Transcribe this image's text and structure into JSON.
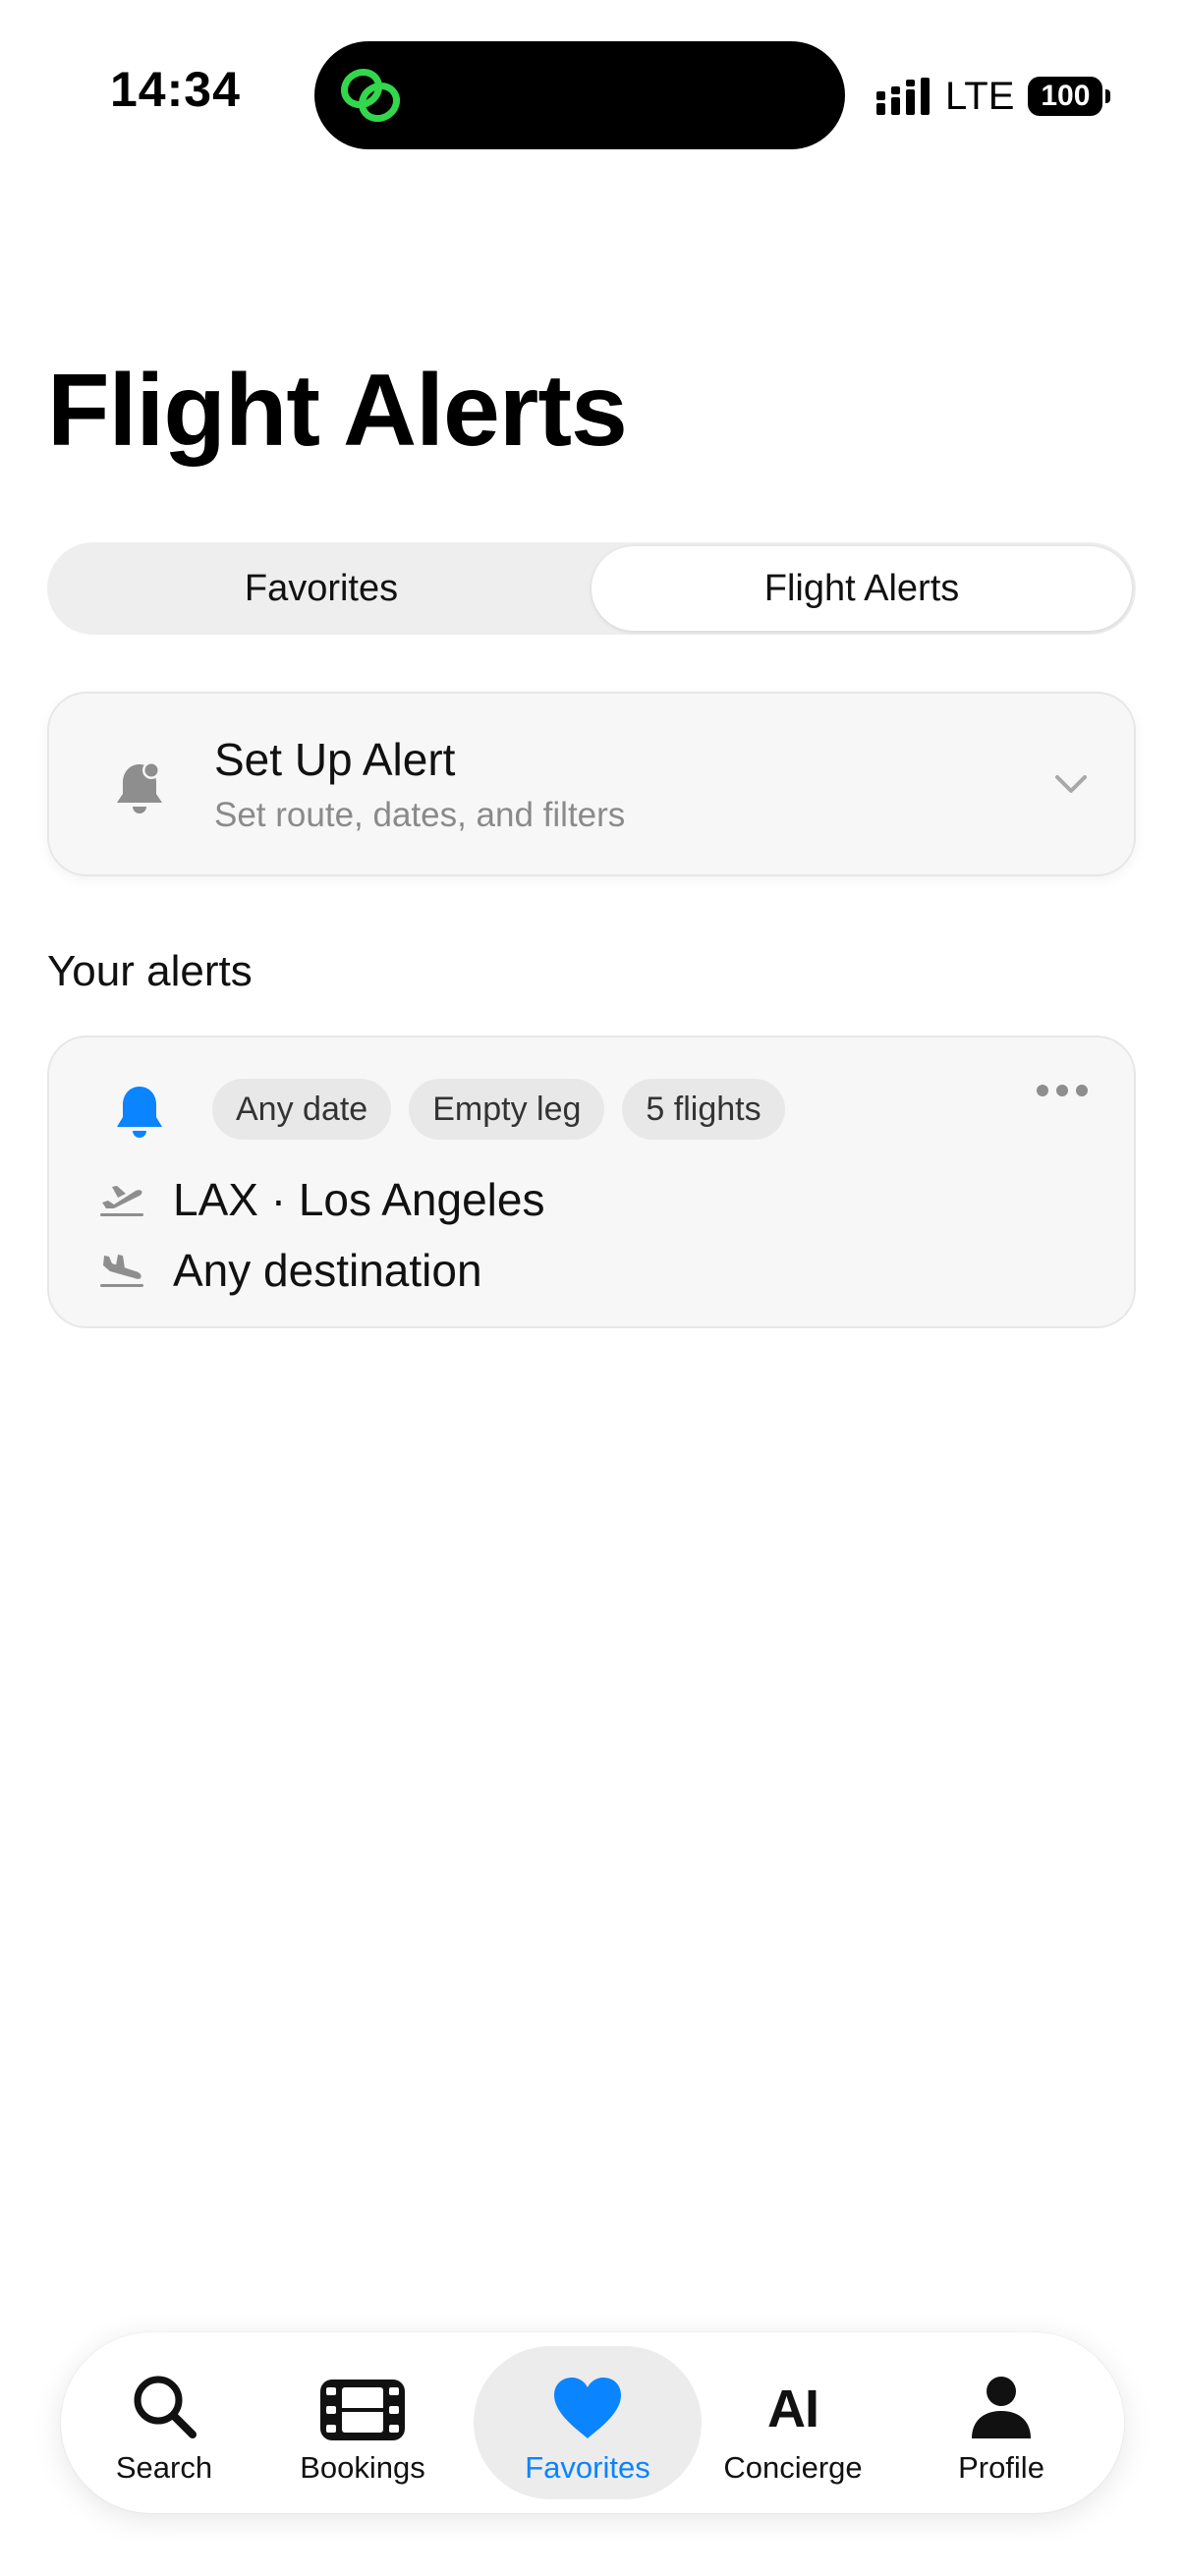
{
  "status_bar": {
    "time": "14:34",
    "network": "LTE",
    "battery": "100"
  },
  "page": {
    "title": "Flight Alerts"
  },
  "segmented": {
    "items": [
      {
        "label": "Favorites",
        "active": false
      },
      {
        "label": "Flight Alerts",
        "active": true
      }
    ]
  },
  "setup_alert": {
    "title": "Set Up Alert",
    "subtitle": "Set route, dates, and filters",
    "icon": "bell-badge-icon"
  },
  "alerts_section": {
    "title": "Your alerts",
    "alerts": [
      {
        "chips": [
          "Any date",
          "Empty leg",
          "5 flights"
        ],
        "from": "LAX · Los Angeles",
        "to": "Any destination"
      }
    ]
  },
  "tabbar": {
    "items": [
      {
        "label": "Search",
        "icon": "search-icon",
        "active": false
      },
      {
        "label": "Bookings",
        "icon": "film-icon",
        "active": false
      },
      {
        "label": "Favorites",
        "icon": "heart-icon",
        "active": true
      },
      {
        "label": "Concierge",
        "icon": "ai-icon",
        "glyph": "AI",
        "active": false
      },
      {
        "label": "Profile",
        "icon": "person-icon",
        "active": false
      }
    ]
  },
  "colors": {
    "accent": "#0a84ff",
    "island_logo": "#32d74b",
    "card_bg": "#f7f7f7",
    "muted_text": "#8a8a8a"
  }
}
